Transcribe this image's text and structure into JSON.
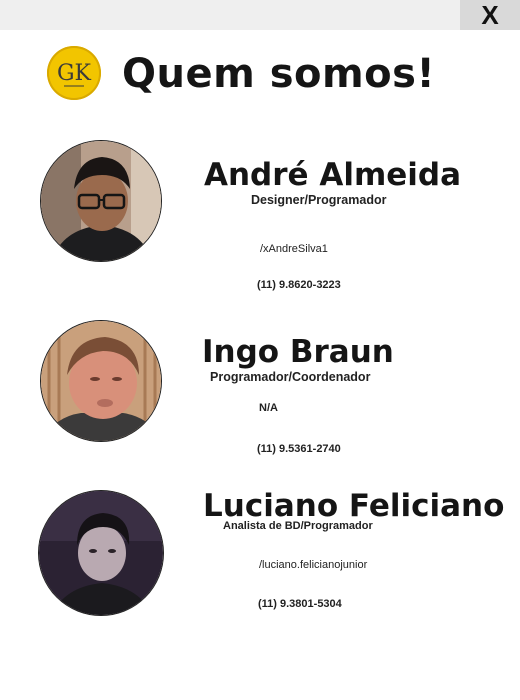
{
  "window": {
    "close_label": "X"
  },
  "header": {
    "title": "Quem somos!",
    "logo_text": "GK"
  },
  "members": [
    {
      "name": "André Almeida",
      "role": "Designer/Programador",
      "social": "/xAndreSilva1",
      "phone": "(11) 9.8620-3223",
      "photo": "photo-andre"
    },
    {
      "name": "Ingo Braun",
      "role": "Programador/Coordenador",
      "social": "N/A",
      "phone": "(11) 9.5361-2740",
      "photo": "photo-ingo"
    },
    {
      "name": "Luciano Feliciano",
      "role": "Analista de BD/Programador",
      "social": "/luciano.felicianojunior",
      "phone": "(11) 9.3801-5304",
      "photo": "photo-luciano"
    }
  ],
  "colors": {
    "logo": "#f2c500",
    "titlebar": "#efefef",
    "close_button": "#d9d9d9"
  }
}
